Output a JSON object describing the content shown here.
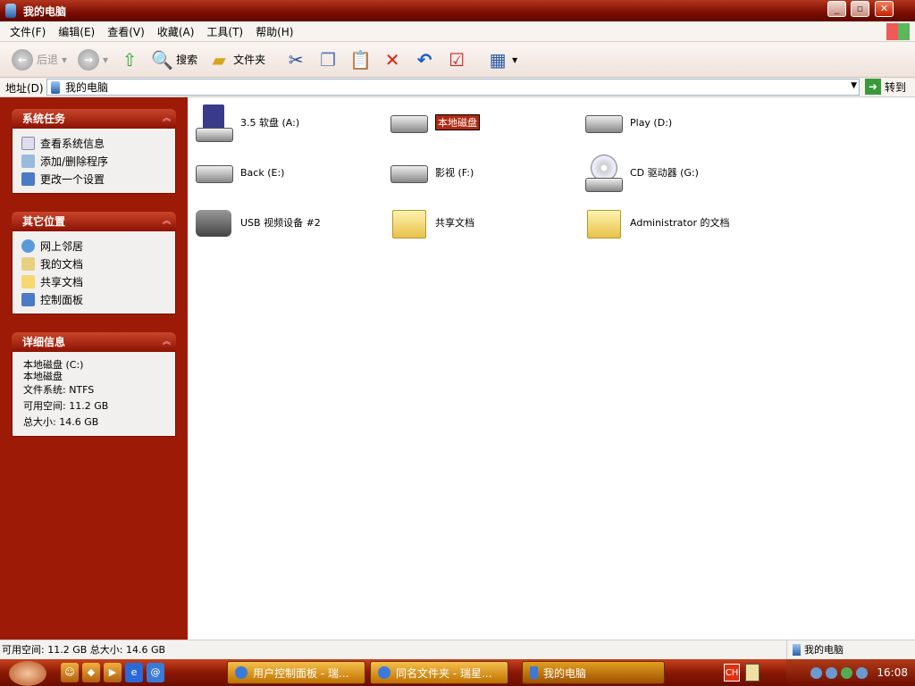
{
  "window": {
    "title": "我的电脑"
  },
  "menu": [
    "文件(F)",
    "编辑(E)",
    "查看(V)",
    "收藏(A)",
    "工具(T)",
    "帮助(H)"
  ],
  "toolbar": {
    "back": "后退",
    "search": "搜索",
    "folders": "文件夹"
  },
  "address": {
    "label": "地址(D)",
    "value": "我的电脑",
    "go": "转到"
  },
  "sidebar": {
    "system_tasks": {
      "title": "系统任务",
      "items": [
        "查看系统信息",
        "添加/删除程序",
        "更改一个设置"
      ]
    },
    "other_places": {
      "title": "其它位置",
      "items": [
        "网上邻居",
        "我的文档",
        "共享文档",
        "控制面板"
      ]
    },
    "details": {
      "title": "详细信息",
      "name": "本地磁盘 (C:)",
      "type": "本地磁盘",
      "fs": "文件系统: NTFS",
      "free": "可用空间: 11.2 GB",
      "total": "总大小: 14.6 GB"
    }
  },
  "items": [
    {
      "label": "3.5 软盘 (A:)",
      "kind": "floppy"
    },
    {
      "label": "本地磁盘",
      "kind": "drive",
      "renaming": true
    },
    {
      "label": "Play (D:)",
      "kind": "drive"
    },
    {
      "label": "Back (E:)",
      "kind": "drive"
    },
    {
      "label": "影视 (F:)",
      "kind": "drive"
    },
    {
      "label": "CD 驱动器 (G:)",
      "kind": "cd"
    },
    {
      "label": "USB 视频设备 #2",
      "kind": "cam"
    },
    {
      "label": "共享文档",
      "kind": "folder"
    },
    {
      "label": "Administrator 的文档",
      "kind": "folder"
    }
  ],
  "status": {
    "left": "可用空间: 11.2 GB 总大小: 14.6 GB",
    "right": "我的电脑"
  },
  "taskbar": {
    "buttons": [
      "用户控制面板 - 瑞...",
      "同名文件夹 - 瑞星...",
      "我的电脑"
    ],
    "lang": "CH",
    "clock": "16:08"
  }
}
